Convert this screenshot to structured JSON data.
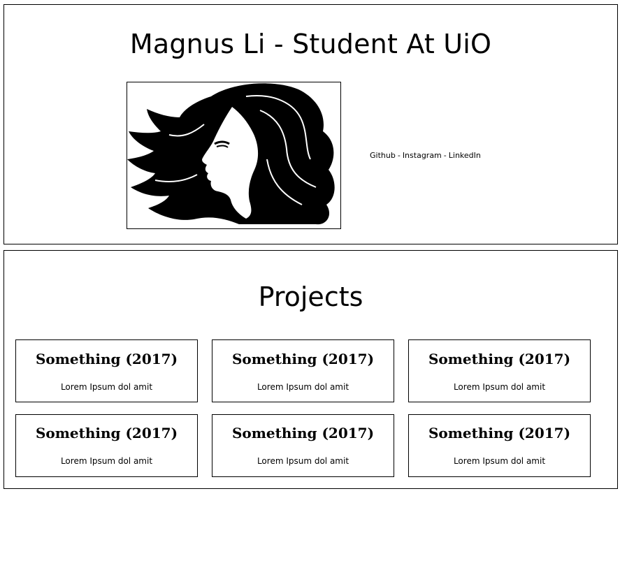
{
  "header": {
    "title": "Magnus Li - Student At UiO",
    "portrait_icon": "woman-silhouette-icon",
    "links": [
      {
        "label": "Github"
      },
      {
        "label": "Instagram"
      },
      {
        "label": "LinkedIn"
      }
    ],
    "separator": "-"
  },
  "projects": {
    "title": "Projects",
    "items": [
      {
        "title": "Something (2017)",
        "description": "Lorem Ipsum dol amit"
      },
      {
        "title": "Something (2017)",
        "description": "Lorem Ipsum dol amit"
      },
      {
        "title": "Something (2017)",
        "description": "Lorem Ipsum dol amit"
      },
      {
        "title": "Something (2017)",
        "description": "Lorem Ipsum dol amit"
      },
      {
        "title": "Something (2017)",
        "description": "Lorem Ipsum dol amit"
      },
      {
        "title": "Something (2017)",
        "description": "Lorem Ipsum dol amit"
      }
    ]
  }
}
